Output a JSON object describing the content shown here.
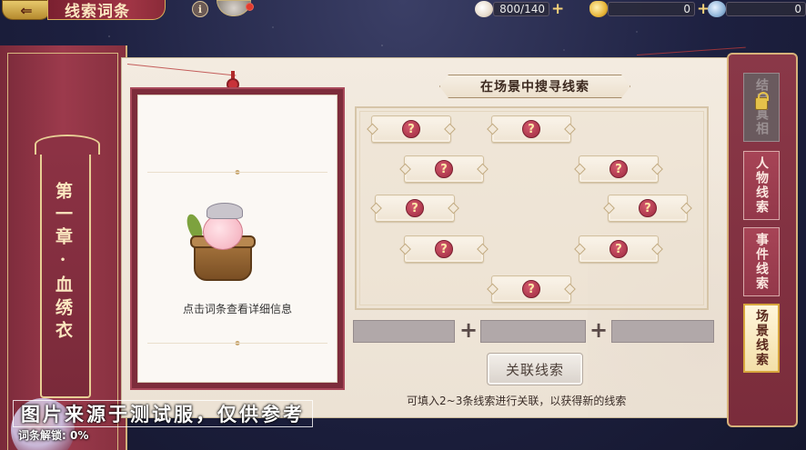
{
  "header": {
    "back_glyph": "⇐",
    "title": "线索词条",
    "info_glyph": "i",
    "resources": [
      {
        "icon": "peach-bun-icon",
        "value": "800/140",
        "color": "#f1e6d8"
      },
      {
        "icon": "gold-ingot-icon",
        "value": "0",
        "color": "#e8b63a"
      },
      {
        "icon": "jade-coin-icon",
        "value": "0",
        "color": "#8fb4d8"
      }
    ],
    "plus_glyph": "+"
  },
  "chapter": {
    "label": "第一章·血绣衣"
  },
  "clue_card": {
    "hint": "点击词条查看详细信息"
  },
  "search": {
    "title": "在场景中搜寻线索",
    "slot_glyph": "?",
    "slots": [
      {
        "state": "hidden"
      },
      {
        "state": "hidden"
      },
      {
        "state": "hidden"
      },
      {
        "state": "hidden"
      },
      {
        "state": "hidden"
      },
      {
        "state": "hidden"
      },
      {
        "state": "hidden"
      },
      {
        "state": "hidden"
      },
      {
        "state": "hidden"
      }
    ]
  },
  "link": {
    "plus_glyph": "+",
    "button_label": "关联线索",
    "hint": "可填入2~3条线索进行关联，以获得新的线索"
  },
  "tabs": [
    {
      "label": "结局真相",
      "state": "locked"
    },
    {
      "label": "人物线索",
      "state": "normal"
    },
    {
      "label": "事件线索",
      "state": "normal"
    },
    {
      "label": "场景线索",
      "state": "active"
    }
  ],
  "overlay": {
    "watermark": "图片来源于测试服，仅供参考",
    "unlock_text": "词条解锁: 0%"
  },
  "colors": {
    "accent_red": "#7d2c3b",
    "gold": "#d7b27a",
    "parchment": "#f3ebe0"
  }
}
